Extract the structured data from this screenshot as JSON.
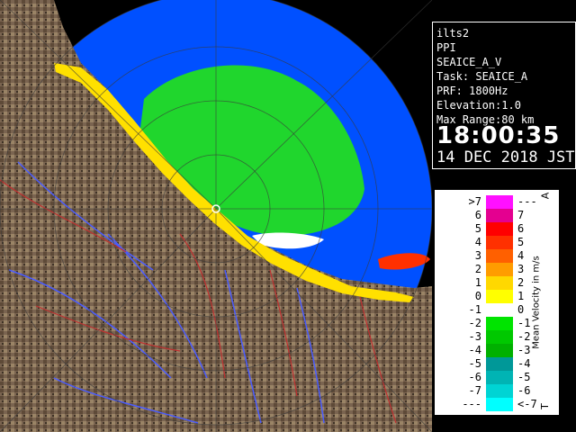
{
  "info": {
    "site": "ilts2",
    "scan_type": "PPI",
    "product": "SEAICE_A_V",
    "task": "Task: SEAICE_A",
    "prf": "PRF: 1800Hz",
    "elevation": "Elevation:1.0",
    "max_range": "Max Range:80 km",
    "time": "18:00:35",
    "date": "14 DEC 2018 JST"
  },
  "legend": {
    "title": "Mean Velocity in m/s",
    "top_mark": "A",
    "bottom_mark": "T",
    "rows": [
      {
        "left": ">7",
        "right": "---",
        "color": "#ff10ff"
      },
      {
        "left": "6",
        "right": "7",
        "color": "#e40090"
      },
      {
        "left": "5",
        "right": "6",
        "color": "#ff0000"
      },
      {
        "left": "4",
        "right": "5",
        "color": "#ff3000"
      },
      {
        "left": "3",
        "right": "4",
        "color": "#ff6000"
      },
      {
        "left": "2",
        "right": "3",
        "color": "#ff9c00"
      },
      {
        "left": "1",
        "right": "2",
        "color": "#ffd800"
      },
      {
        "left": "0",
        "right": "1",
        "color": "#ffff00"
      },
      {
        "left": "-1",
        "right": "0",
        "color": "#ffffff"
      },
      {
        "left": "-2",
        "right": "-1",
        "color": "#00e400"
      },
      {
        "left": "-3",
        "right": "-2",
        "color": "#00c800"
      },
      {
        "left": "-4",
        "right": "-3",
        "color": "#00b000"
      },
      {
        "left": "-5",
        "right": "-4",
        "color": "#009898"
      },
      {
        "left": "-6",
        "right": "-5",
        "color": "#00b4b4"
      },
      {
        "left": "-7",
        "right": "-6",
        "color": "#00d4d4"
      },
      {
        "left": "---",
        "right": "<-7",
        "color": "#00ffff"
      }
    ]
  },
  "colors": {
    "sea_echo": "#0050ff",
    "land": "#7a6450",
    "rivers": "#4a5cff",
    "boundaries": "#c03030"
  }
}
